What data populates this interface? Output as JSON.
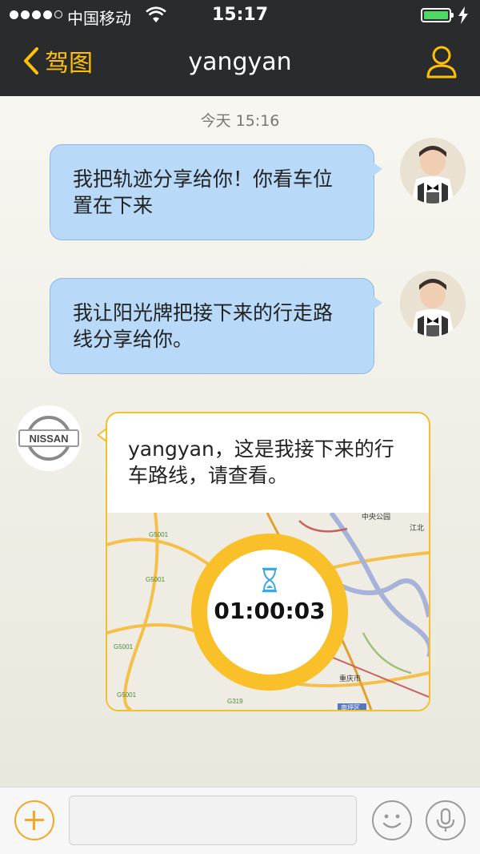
{
  "status_bar": {
    "carrier": "中国移动",
    "time": "15:17",
    "signal_bars_filled": 4,
    "signal_bars_total": 5,
    "battery_level": 1.0
  },
  "nav": {
    "back_label": "驾图",
    "title": "yangyan",
    "back_icon": "chevron-left-icon",
    "profile_icon": "user-icon",
    "accent_color": "#ffc107"
  },
  "chat": {
    "timestamp": "今天 15:16",
    "messages": [
      {
        "text": "我把轨迹分享给你！你看车位置在下来"
      },
      {
        "text": "我让阳光牌把接下来的行走路线分享给你。"
      }
    ],
    "card": {
      "text": "yangyan，这是我接下来的行车路线，请查看。",
      "timer": "01:00:03",
      "timer_icon": "hourglass-icon",
      "map_labels": [
        "G5001",
        "G5001",
        "G5001",
        "G5001",
        "G319",
        "重庆市",
        "中央公园",
        "江北",
        "南坪区"
      ]
    },
    "sender_avatar_brand": "NISSAN"
  },
  "input_bar": {
    "plus_icon": "plus-icon",
    "emoji_icon": "smiley-icon",
    "mic_icon": "microphone-icon"
  }
}
